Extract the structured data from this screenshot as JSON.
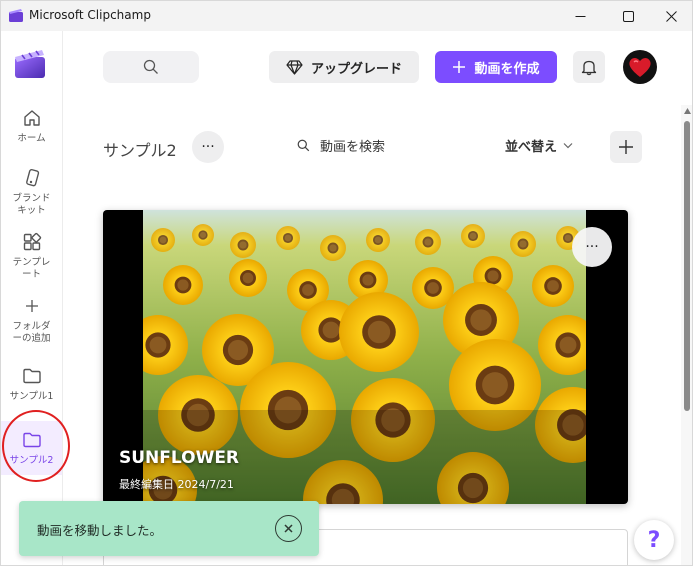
{
  "window": {
    "title": "Microsoft Clipchamp",
    "minimize_icon": "minimize-icon",
    "maximize_icon": "maximize-icon",
    "close_icon": "close-icon"
  },
  "sidebar": {
    "logo_icon": "clipchamp-logo",
    "items": [
      {
        "label": "ホーム",
        "icon": "home-icon"
      },
      {
        "label": "ブランド\nキット",
        "icon": "brand-kit-icon"
      },
      {
        "label": "テンプレ\nート",
        "icon": "template-icon"
      },
      {
        "label": "フォルダ\nーの追加",
        "icon": "plus-icon"
      },
      {
        "label": "サンプル1",
        "icon": "folder-icon"
      },
      {
        "label": "サンプル2",
        "icon": "folder-icon",
        "active": true
      }
    ]
  },
  "topbar": {
    "search_icon": "search-icon",
    "upgrade_label": "アップグレード",
    "upgrade_icon": "diamond-icon",
    "create_label": "動画を作成",
    "create_icon": "plus-icon",
    "bell_icon": "bell-icon",
    "avatar_icon": "heart-avatar"
  },
  "folder": {
    "title": "サンプル2",
    "more_label": "···",
    "search_label": "動画を検索",
    "sort_label": "並べ替え",
    "sort_icon": "chevron-down-icon",
    "add_icon": "plus-icon"
  },
  "video_card": {
    "title": "SUNFLOWER",
    "date": "最終編集日 2024/7/21",
    "more_label": "···"
  },
  "toast": {
    "message": "動画を移動しました。",
    "close_icon": "close-icon"
  },
  "help": {
    "label": "?"
  },
  "colors": {
    "accent": "#7c4dff",
    "toast": "#a8e6c8",
    "annotation_circle": "#e02020"
  }
}
